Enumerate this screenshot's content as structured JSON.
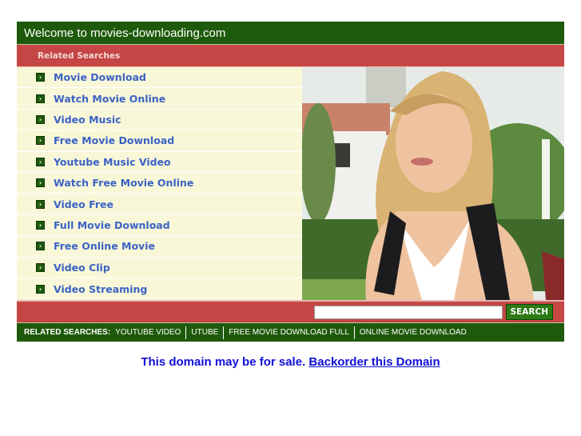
{
  "header": {
    "title": "Welcome to movies-downloading.com"
  },
  "related_heading": "Related Searches",
  "links": [
    "Movie Download",
    "Watch Movie Online",
    "Video Music",
    "Free Movie Download",
    "Youtube Music Video",
    "Watch Free Movie Online",
    "Video Free",
    "Full Movie Download",
    "Free Online Movie",
    "Video Clip",
    "Video Streaming"
  ],
  "bullet_icon": "arrow-right-icon",
  "photo": {
    "alt": "smiling-woman-with-backpack"
  },
  "search": {
    "value": "",
    "button_label": "SEARCH"
  },
  "bottom": {
    "label": "RELATED SEARCHES:",
    "links": [
      "YOUTUBE VIDEO",
      "UTUBE",
      "FREE MOVIE DOWNLOAD FULL",
      "ONLINE MOVIE DOWNLOAD"
    ]
  },
  "sale": {
    "text": "This domain may be for sale.",
    "link": "Backorder this Domain"
  },
  "colors": {
    "green": "#1e5a0b",
    "red": "#c64545",
    "cream": "#f8f7d8",
    "link_blue": "#3b63c4"
  }
}
